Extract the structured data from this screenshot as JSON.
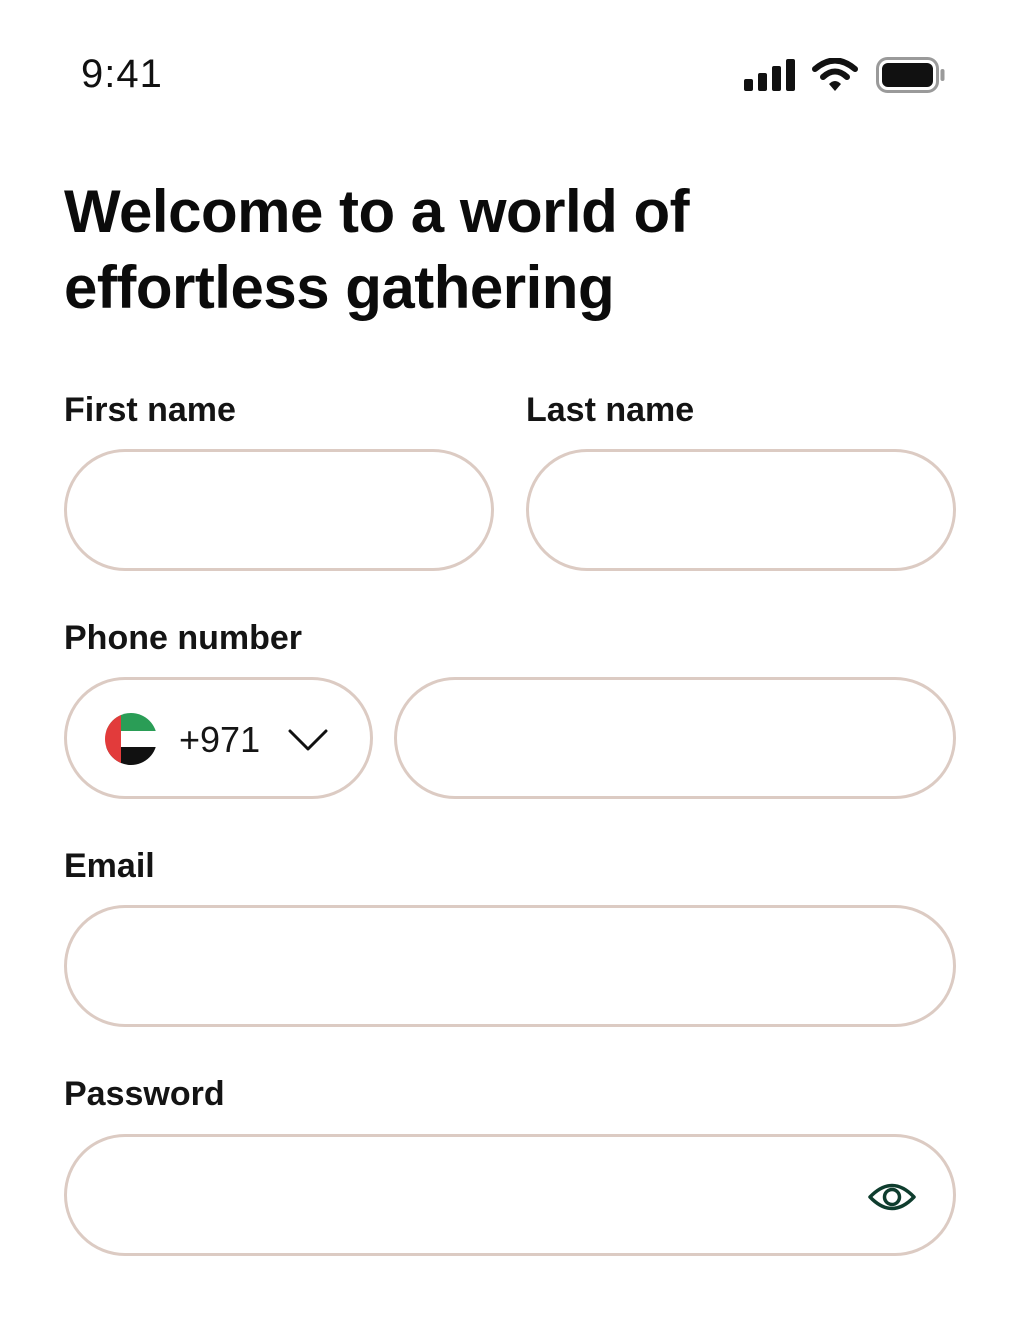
{
  "status_bar": {
    "time": "9:41",
    "icons": [
      "cellular-signal-icon",
      "wifi-icon",
      "battery-icon"
    ]
  },
  "headline": {
    "line1": "Welcome to a world of",
    "line2": "effortless gathering"
  },
  "form": {
    "first_name": {
      "label": "First name",
      "value": ""
    },
    "last_name": {
      "label": "Last name",
      "value": ""
    },
    "phone": {
      "label": "Phone number",
      "country_flag": "uae-flag-icon",
      "country_code": "+971",
      "value": ""
    },
    "email": {
      "label": "Email",
      "value": ""
    },
    "password": {
      "label": "Password",
      "value": "",
      "toggle_icon": "eye-icon"
    }
  },
  "colors": {
    "input_border": "#dccbc3",
    "eye_icon": "#0f3d2e",
    "text": "#111111"
  }
}
